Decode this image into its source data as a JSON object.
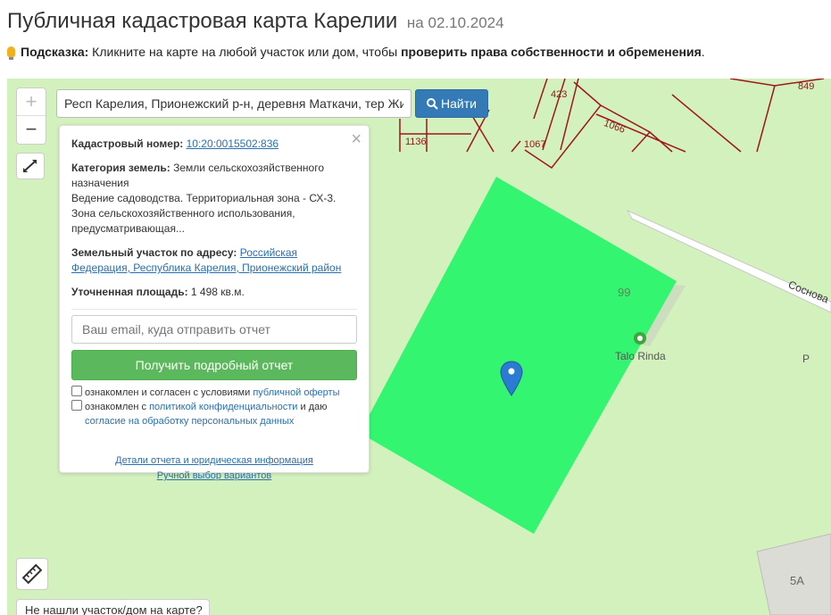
{
  "header": {
    "title": "Публичная кадастровая карта Карелии",
    "date": "на 02.10.2024"
  },
  "hint": {
    "label": "Подсказка:",
    "text": " Кликните на карте на любой участок или дом, чтобы ",
    "bold": "проверить права собственности и обременения",
    "end": "."
  },
  "search": {
    "value": "Респ Карелия, Прионежский р-н, деревня Маткачи, тер Жи...",
    "button": "Найти"
  },
  "zoom": {
    "plus": "+",
    "minus": "−"
  },
  "card": {
    "cad_label": "Кадастровый номер:",
    "cad_value": "10:20:0015502:836",
    "cat_label": "Категория земель:",
    "cat_value": " Земли сельскохозяйственного назначения",
    "cat_desc": "Ведение садоводства. Территориальная зона - СХ-3. Зона сельскохозяйственного использования, предусматривающая...",
    "addr_label": "Земельный участок по адресу:",
    "addr_value": "Российская Федерация, Республика Карелия, Прионежский район",
    "area_label": "Уточненная площадь:",
    "area_value": " 1 498 кв.м.",
    "email_placeholder": "Ваш email, куда отправить отчет",
    "get_button": "Получить подробный отчет",
    "check1_text": "ознакомлен и согласен с условиями ",
    "check1_link": "публичной оферты",
    "check2_text": "ознакомлен с ",
    "check2_link": "политикой конфиденциальности",
    "check2_mid": " и даю",
    "check2_link2": "согласие на обработку персональных данных",
    "link_details": "Детали отчета и юридическая информация",
    "link_manual": "Ручной выбор вариантов"
  },
  "map": {
    "labels": {
      "l423": "423",
      "l1066": "1066",
      "l1136": "1136",
      "l1067": "1067",
      "l849": "849",
      "l99": "99",
      "poi": "Talo Rinda",
      "street": "Соснова",
      "p": "P",
      "l5a": "5A"
    },
    "colors": {
      "background": "#d3f1bd",
      "parcel": "#33f56f",
      "boundary": "#a0151e",
      "marker": "#2b7bd2"
    }
  },
  "notfound": "Не нашли участок/дом на карте?"
}
